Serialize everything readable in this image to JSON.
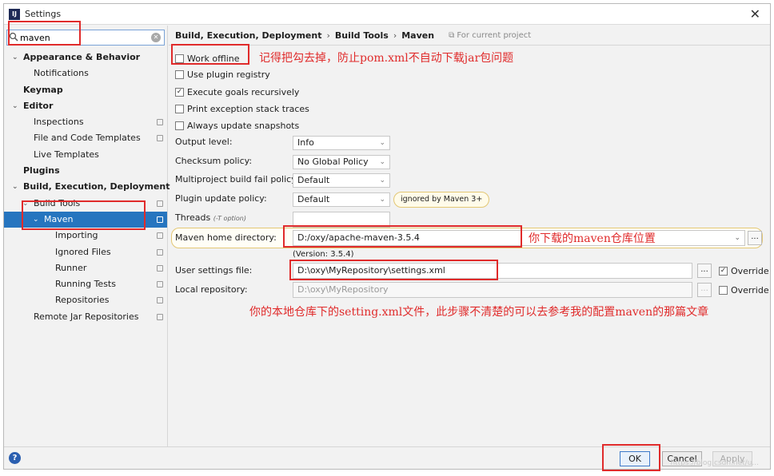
{
  "window": {
    "title": "Settings",
    "app_icon": "intellij-icon",
    "close_glyph": "✕"
  },
  "search": {
    "value": "maven",
    "icon": "search-icon"
  },
  "tree": [
    {
      "label": "Appearance & Behavior",
      "bold": true,
      "arrow": "⌄",
      "indent": 0
    },
    {
      "label": "Notifications",
      "indent": 1
    },
    {
      "label": "Keymap",
      "bold": true,
      "indent": 0
    },
    {
      "label": "Editor",
      "bold": true,
      "arrow": "⌄",
      "indent": 0
    },
    {
      "label": "Inspections",
      "indent": 1,
      "copy": true
    },
    {
      "label": "File and Code Templates",
      "indent": 1,
      "copy": true
    },
    {
      "label": "Live Templates",
      "indent": 1
    },
    {
      "label": "Plugins",
      "bold": true,
      "indent": 0
    },
    {
      "label": "Build, Execution, Deployment",
      "bold": true,
      "arrow": "⌄",
      "indent": 0
    },
    {
      "label": "Build Tools",
      "indent": 1,
      "arrow": "⌄",
      "copy": true
    },
    {
      "label": "Maven",
      "indent": 2,
      "arrow": "⌄",
      "copy": true,
      "selected": true
    },
    {
      "label": "Importing",
      "indent": 3,
      "copy": true
    },
    {
      "label": "Ignored Files",
      "indent": 3,
      "copy": true
    },
    {
      "label": "Runner",
      "indent": 3,
      "copy": true
    },
    {
      "label": "Running Tests",
      "indent": 3,
      "copy": true
    },
    {
      "label": "Repositories",
      "indent": 3,
      "copy": true
    },
    {
      "label": "Remote Jar Repositories",
      "indent": 1,
      "copy": true
    }
  ],
  "breadcrumb": {
    "items": [
      "Build, Execution, Deployment",
      "Build Tools",
      "Maven"
    ],
    "separator": "›",
    "scope": "For current project"
  },
  "checkboxes": {
    "work_offline": {
      "label": "Work offline",
      "checked": false
    },
    "use_plugin_registry": {
      "label": "Use plugin registry",
      "checked": false
    },
    "execute_goals": {
      "label": "Execute goals recursively",
      "checked": true
    },
    "print_exception": {
      "label": "Print exception stack traces",
      "checked": false
    },
    "always_update": {
      "label": "Always update snapshots",
      "checked": false
    }
  },
  "fields": {
    "output_level": {
      "label": "Output level:",
      "value": "Info"
    },
    "checksum_policy": {
      "label": "Checksum policy:",
      "value": "No Global Policy"
    },
    "multiproject_fail": {
      "label": "Multiproject build fail policy:",
      "value": "Default"
    },
    "plugin_update": {
      "label": "Plugin update policy:",
      "value": "Default",
      "note": "ignored by Maven 3+"
    },
    "threads": {
      "label": "Threads",
      "hint": "(-T option)",
      "value": ""
    },
    "maven_home": {
      "label": "Maven home directory:",
      "value": "D:/oxy/apache-maven-3.5.4",
      "version": "(Version: 3.5.4)"
    },
    "user_settings": {
      "label": "User settings file:",
      "value": "D:\\oxy\\MyRepository\\settings.xml",
      "override": "Override",
      "override_checked": true
    },
    "local_repo": {
      "label": "Local repository:",
      "value": "D:\\oxy\\MyRepository",
      "override": "Override",
      "override_checked": false
    }
  },
  "annotations": {
    "offline_note": "记得把勾去掉，防止pom.xml不自动下载jar包问题",
    "maven_home_note": "你下载的maven仓库位置",
    "settings_note": "你的本地仓库下的setting.xml文件，此步骤不清楚的可以去参考我的配置maven的那篇文章"
  },
  "buttons": {
    "ok": "OK",
    "cancel": "Cancel",
    "apply": "Apply",
    "help": "?",
    "browse": "..."
  },
  "watermark": "https://blog.csdn.net/u...",
  "colors": {
    "selection": "#2675bf",
    "annotation_red": "#e02b2b",
    "highlight_border": "#e3c774"
  }
}
